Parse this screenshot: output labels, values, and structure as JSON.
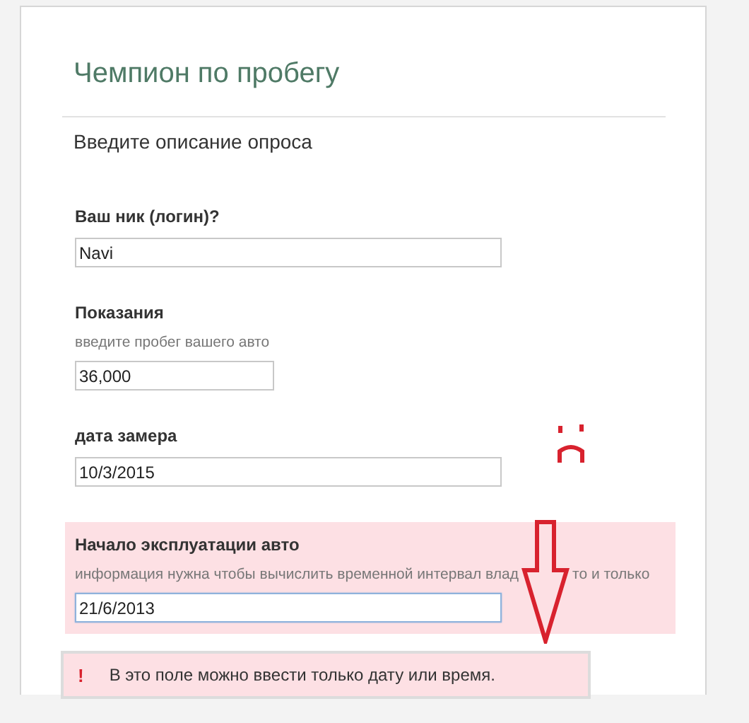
{
  "form": {
    "title": "Чемпион по пробегу",
    "subtitle": "Введите описание опроса"
  },
  "questions": [
    {
      "label": "Ваш ник (логин)?",
      "value": "Navi",
      "kind": "wide",
      "error": false,
      "focused": false
    },
    {
      "label": "Показания",
      "hint": [
        "введите пробег вашего авто"
      ],
      "value": "36,000",
      "kind": "narrow",
      "error": false,
      "focused": false
    },
    {
      "label": "дата замера",
      "value": "10/3/2015",
      "kind": "wide",
      "error": false,
      "focused": false
    },
    {
      "label": "Начало эксплуатации авто",
      "hint": [
        "информация нужна чтобы вычислить временной интервал влад",
        "то и только"
      ],
      "value": "21/6/2013",
      "kind": "wide",
      "error": true,
      "focused": true
    }
  ],
  "validation": {
    "icon": "!",
    "message": "В это поле можно ввести только дату или время."
  }
}
